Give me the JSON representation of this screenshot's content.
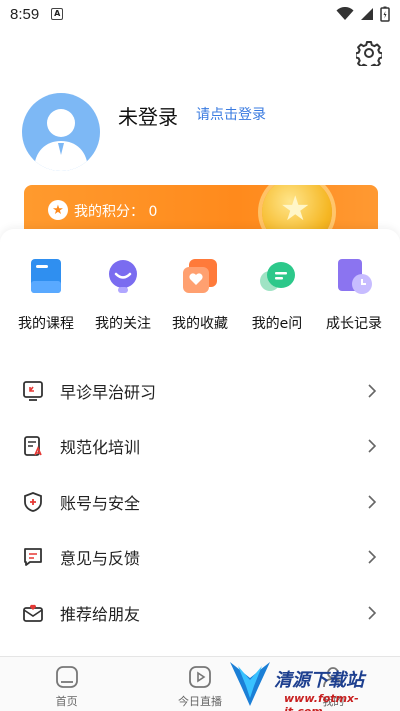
{
  "status_bar": {
    "time": "8:59",
    "notif_glyph": "A"
  },
  "profile": {
    "name": "未登录",
    "login_link": "请点击登录"
  },
  "points": {
    "label": "我的积分：",
    "value": "0"
  },
  "quick_actions": [
    {
      "label": "我的课程",
      "icon": "courses-icon",
      "color": "#2f8ff0"
    },
    {
      "label": "我的关注",
      "icon": "follow-icon",
      "color": "#7a6cf0"
    },
    {
      "label": "我的收藏",
      "icon": "favorites-icon",
      "color": "#ff7a3a"
    },
    {
      "label": "我的e问",
      "icon": "e-question-icon",
      "color": "#2cc88a"
    },
    {
      "label": "成长记录",
      "icon": "growth-record-icon",
      "color": "#8b74f0"
    }
  ],
  "menu": [
    {
      "label": "早诊早治研习",
      "icon": "screen-study-icon"
    },
    {
      "label": "规范化培训",
      "icon": "training-doc-icon"
    },
    {
      "label": "账号与安全",
      "icon": "shield-icon"
    },
    {
      "label": "意见与反馈",
      "icon": "feedback-icon"
    },
    {
      "label": "推荐给朋友",
      "icon": "share-envelope-icon"
    }
  ],
  "tabs": [
    {
      "label": "首页",
      "icon": "home-icon"
    },
    {
      "label": "今日直播",
      "icon": "live-play-icon"
    },
    {
      "label": "我的",
      "icon": "mine-icon"
    }
  ],
  "watermark": {
    "text": "清源下载站",
    "url": "www.fotmx-it.com"
  },
  "colors": {
    "accent": "#3a7be0",
    "points_orange": "#ff8a1c"
  }
}
